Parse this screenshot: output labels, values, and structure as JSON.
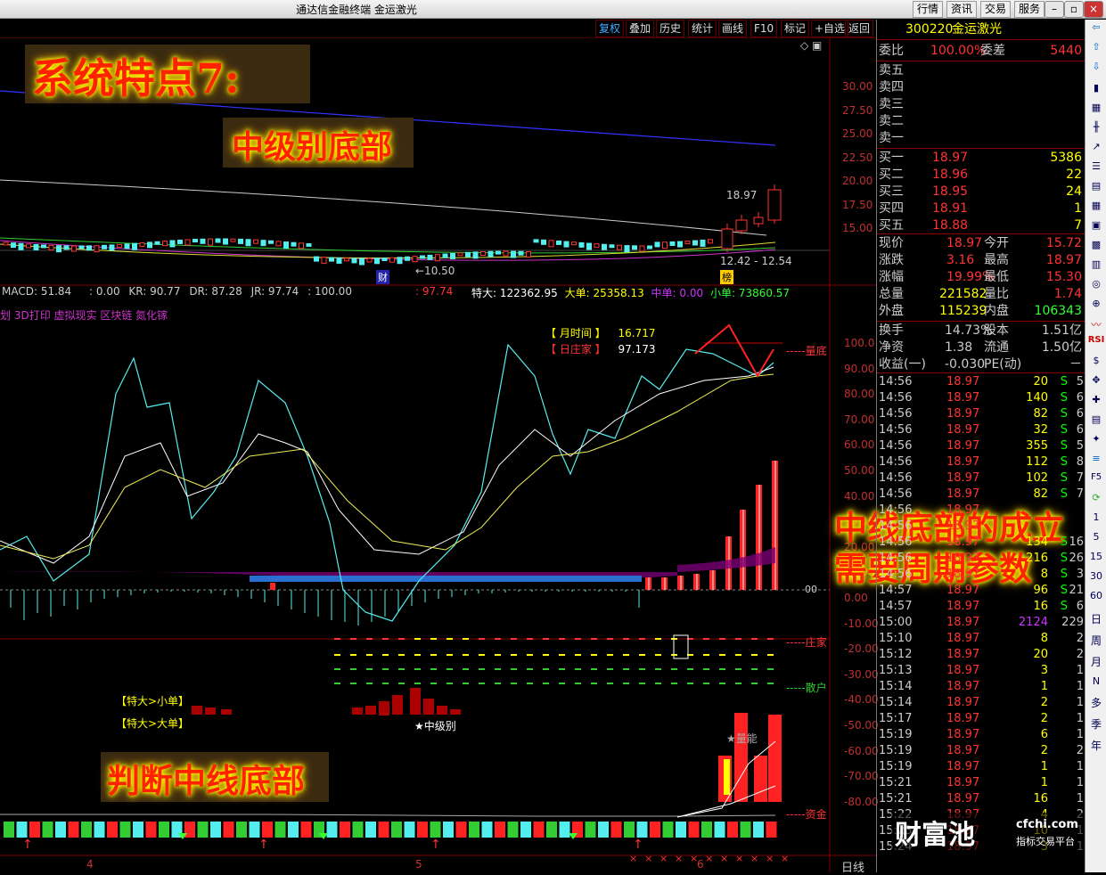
{
  "window": {
    "title": "通达信金融终端 金运激光",
    "menu": [
      "行情",
      "资讯",
      "交易",
      "服务"
    ]
  },
  "toolbar": [
    "复权",
    "叠加",
    "历史",
    "统计",
    "画线",
    "F10",
    "标记",
    "+自选",
    "返回"
  ],
  "price_axis": [
    "30.00",
    "27.50",
    "25.00",
    "22.50",
    "20.00",
    "17.50",
    "15.00"
  ],
  "candle_labels": {
    "high": "18.97",
    "low_left": "←10.50",
    "range": "12.42 - 12.54",
    "cai": "财",
    "bang": "榜"
  },
  "macd_line": {
    "macd": "MACD: 51.84",
    "v1": ": 0.00",
    "kr": "KR: 90.77",
    "dr": "DR: 87.28",
    "jr": "JR: 97.74",
    "v2": ": 100.00",
    "v3": ": 97.74",
    "tebig": "特大: 122362.95",
    "big": "大单: 25358.13",
    "mid": "中单: 0.00",
    "small": "小单: 73860.57"
  },
  "concepts": "划 3D打印 虚拟现实 区块链 氮化镓",
  "legend": {
    "month_label": "【 月时间 】",
    "month_val": "16.717",
    "day_label": "【 日庄家 】",
    "day_val": "97.173"
  },
  "indicator_axis": [
    "100.0",
    "90.00",
    "80.00",
    "70.00",
    "60.00",
    "50.00",
    "40.00",
    "30.00",
    "20.00",
    "10.00",
    "0.00",
    "-10.00",
    "-20.00",
    "-30.00",
    "-40.00",
    "-50.00",
    "-60.00",
    "-70.00",
    "-80.00"
  ],
  "right_labels": {
    "top": "-----量底",
    "zhuangjia": "-----庄家",
    "sanhu": "-----散户",
    "zijin": "-----资金",
    "zero": "00"
  },
  "bottom_labels": {
    "tebig_small": "【特大>小单】",
    "tebig_big": "【特大>大单】",
    "mid_level": "★中级别",
    "energy": "★量能"
  },
  "date_axis": [
    "4",
    "5",
    "6"
  ],
  "period_label": "日线",
  "overlays": {
    "title": "系统特点7:",
    "sub": "中级别底部",
    "right1": "中线底部的成立",
    "right2": "需要周期参数",
    "bottom": "判断中线底部"
  },
  "quote": {
    "code": "300220",
    "name": "金运激光",
    "weibi_label": "委比",
    "weibi": "100.00%",
    "weicha_label": "委差",
    "weicha": "5440",
    "sells": [
      {
        "l": "卖五"
      },
      {
        "l": "卖四"
      },
      {
        "l": "卖三"
      },
      {
        "l": "卖二"
      },
      {
        "l": "卖一"
      }
    ],
    "buys": [
      {
        "l": "买一",
        "p": "18.97",
        "v": "5386"
      },
      {
        "l": "买二",
        "p": "18.96",
        "v": "22"
      },
      {
        "l": "买三",
        "p": "18.95",
        "v": "24"
      },
      {
        "l": "买四",
        "p": "18.91",
        "v": "1"
      },
      {
        "l": "买五",
        "p": "18.88",
        "v": "7"
      }
    ],
    "stats": [
      {
        "a": "现价",
        "b": "18.97",
        "c": "今开",
        "d": "15.72"
      },
      {
        "a": "涨跌",
        "b": "3.16",
        "c": "最高",
        "d": "18.97"
      },
      {
        "a": "涨幅",
        "b": "19.99%",
        "c": "最低",
        "d": "15.30"
      },
      {
        "a": "总量",
        "b": "221582",
        "c": "量比",
        "d": "1.74"
      },
      {
        "a": "外盘",
        "b": "115239",
        "c": "内盘",
        "d": "106343"
      }
    ],
    "fund": [
      {
        "a": "换手",
        "b": "14.73%",
        "c": "股本",
        "d": "1.51亿"
      },
      {
        "a": "净资",
        "b": "1.38",
        "c": "流通",
        "d": "1.50亿"
      },
      {
        "a": "收益(一)",
        "b": "-0.030",
        "c": "PE(动)",
        "d": "－"
      }
    ],
    "ticks": [
      {
        "t": "14:56",
        "p": "18.97",
        "v": "20",
        "s": "S",
        "c": "5"
      },
      {
        "t": "14:56",
        "p": "18.97",
        "v": "140",
        "s": "S",
        "c": "6"
      },
      {
        "t": "14:56",
        "p": "18.97",
        "v": "82",
        "s": "S",
        "c": "6"
      },
      {
        "t": "14:56",
        "p": "18.97",
        "v": "32",
        "s": "S",
        "c": "6"
      },
      {
        "t": "14:56",
        "p": "18.97",
        "v": "355",
        "s": "S",
        "c": "5"
      },
      {
        "t": "14:56",
        "p": "18.97",
        "v": "112",
        "s": "S",
        "c": "8"
      },
      {
        "t": "14:56",
        "p": "18.97",
        "v": "102",
        "s": "S",
        "c": "7"
      },
      {
        "t": "14:56",
        "p": "18.97",
        "v": "82",
        "s": "S",
        "c": "7"
      },
      {
        "t": "14:56",
        "p": "18.97",
        "v": "",
        "s": "",
        "c": ""
      },
      {
        "t": "14:56",
        "p": "18.97",
        "v": "",
        "s": "",
        "c": ""
      },
      {
        "t": "14:56",
        "p": "18.97",
        "v": "134",
        "s": "S",
        "c": "16"
      },
      {
        "t": "14:56",
        "p": "18.97",
        "v": "216",
        "s": "S",
        "c": "26"
      },
      {
        "t": "14:56",
        "p": "18.97",
        "v": "8",
        "s": "S",
        "c": "3"
      },
      {
        "t": "14:57",
        "p": "18.97",
        "v": "96",
        "s": "S",
        "c": "21"
      },
      {
        "t": "14:57",
        "p": "18.97",
        "v": "16",
        "s": "S",
        "c": "6"
      },
      {
        "t": "15:00",
        "p": "18.97",
        "v": "2124",
        "s": "",
        "c": "229"
      },
      {
        "t": "15:10",
        "p": "18.97",
        "v": "8",
        "s": "",
        "c": "2"
      },
      {
        "t": "15:12",
        "p": "18.97",
        "v": "20",
        "s": "",
        "c": "2"
      },
      {
        "t": "15:13",
        "p": "18.97",
        "v": "3",
        "s": "",
        "c": "1"
      },
      {
        "t": "15:14",
        "p": "18.97",
        "v": "1",
        "s": "",
        "c": "1"
      },
      {
        "t": "15:14",
        "p": "18.97",
        "v": "2",
        "s": "",
        "c": "1"
      },
      {
        "t": "15:17",
        "p": "18.97",
        "v": "2",
        "s": "",
        "c": "1"
      },
      {
        "t": "15:19",
        "p": "18.97",
        "v": "6",
        "s": "",
        "c": "1"
      },
      {
        "t": "15:19",
        "p": "18.97",
        "v": "2",
        "s": "",
        "c": "2"
      },
      {
        "t": "15:19",
        "p": "18.97",
        "v": "1",
        "s": "",
        "c": "1"
      },
      {
        "t": "15:21",
        "p": "18.97",
        "v": "1",
        "s": "",
        "c": "1"
      },
      {
        "t": "15:21",
        "p": "18.97",
        "v": "16",
        "s": "",
        "c": "1"
      },
      {
        "t": "15:22",
        "p": "18.97",
        "v": "4",
        "s": "",
        "c": "2"
      },
      {
        "t": "15:23",
        "p": "18.97",
        "v": "10",
        "s": "",
        "c": "1"
      },
      {
        "t": "15:24",
        "p": "18.97",
        "v": "3",
        "s": "",
        "c": "1"
      }
    ]
  },
  "watermark": {
    "name": "财富池",
    "site": "cfchi.com",
    "sub": "指标交易平台"
  },
  "sidebar": [
    "RSI",
    "F5",
    "1",
    "5",
    "15",
    "30",
    "60",
    "日",
    "周",
    "月",
    "N",
    "多",
    "季",
    "年"
  ]
}
